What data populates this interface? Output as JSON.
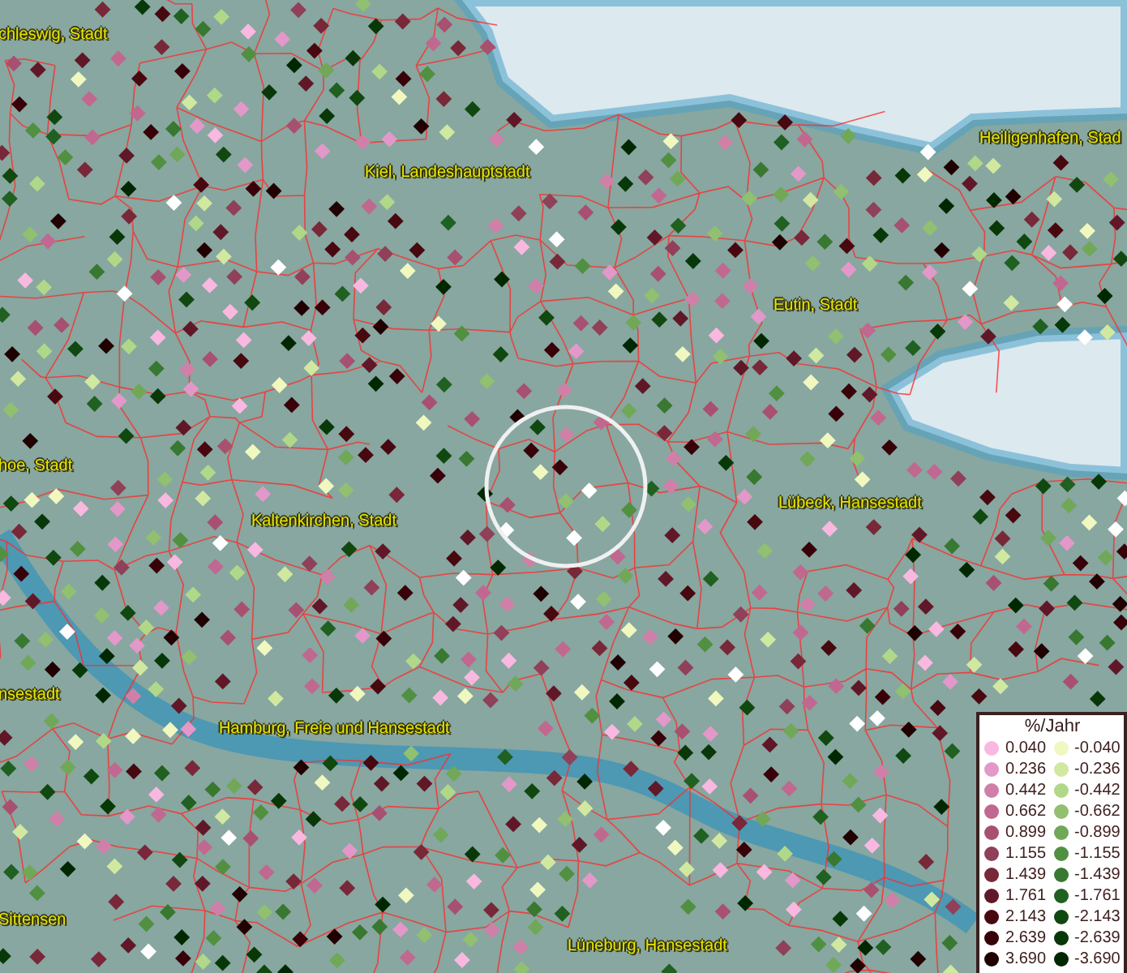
{
  "map": {
    "labels": [
      {
        "text": "chleswig, Stadt"
      },
      {
        "text": "Kiel, Landeshauptstadt"
      },
      {
        "text": "Heiligenhafen, Stad"
      },
      {
        "text": "Eutin, Stadt"
      },
      {
        "text": "hoe, Stadt"
      },
      {
        "text": "Kaltenkirchen, Stadt"
      },
      {
        "text": "Lübeck, Hansestadt"
      },
      {
        "text": "nsestadt"
      },
      {
        "text": "Hamburg, Freie und Hansestadt"
      },
      {
        "text": "Sittensen"
      },
      {
        "text": "Lüneburg, Hansestadt"
      }
    ]
  },
  "legend": {
    "title": "%/Jahr",
    "increase": [
      {
        "value": "0.040",
        "color": "#f8b8e0"
      },
      {
        "value": "0.236",
        "color": "#e298c8"
      },
      {
        "value": "0.442",
        "color": "#d080a8"
      },
      {
        "value": "0.662",
        "color": "#c06890"
      },
      {
        "value": "0.899",
        "color": "#a85070"
      },
      {
        "value": "1.155",
        "color": "#904058"
      },
      {
        "value": "1.439",
        "color": "#782838"
      },
      {
        "value": "1.761",
        "color": "#601828"
      },
      {
        "value": "2.143",
        "color": "#480810"
      },
      {
        "value": "2.639",
        "color": "#380008"
      },
      {
        "value": "3.690",
        "color": "#200000"
      }
    ],
    "decrease": [
      {
        "value": "-0.040",
        "color": "#f0f8c0"
      },
      {
        "value": "-0.236",
        "color": "#d0e8a0"
      },
      {
        "value": "-0.442",
        "color": "#b0d888"
      },
      {
        "value": "-0.662",
        "color": "#90c070"
      },
      {
        "value": "-0.899",
        "color": "#70a858"
      },
      {
        "value": "-1.155",
        "color": "#509040"
      },
      {
        "value": "-1.439",
        "color": "#387830"
      },
      {
        "value": "-1.761",
        "color": "#206020"
      },
      {
        "value": "-2.143",
        "color": "#104810"
      },
      {
        "value": "-2.639",
        "color": "#083808"
      },
      {
        "value": "-3.690",
        "color": "#002800"
      }
    ]
  }
}
